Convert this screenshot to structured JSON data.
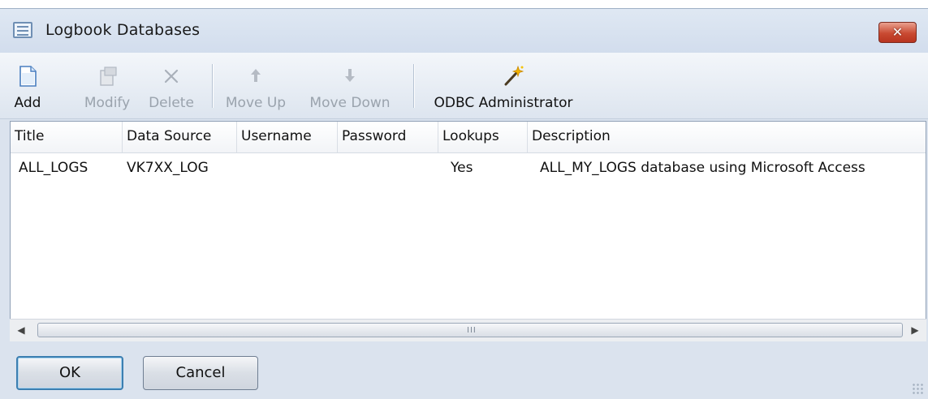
{
  "window": {
    "title": "Logbook Databases",
    "close_glyph": "✕"
  },
  "toolbar": {
    "buttons": [
      {
        "label": "Add",
        "icon": "new-document-icon",
        "enabled": true
      },
      {
        "label": "Modify",
        "icon": "modify-icon",
        "enabled": false
      },
      {
        "label": "Delete",
        "icon": "delete-x-icon",
        "enabled": false
      },
      {
        "label": "Move Up",
        "icon": "arrow-up-icon",
        "enabled": false
      },
      {
        "label": "Move Down",
        "icon": "arrow-down-icon",
        "enabled": false
      },
      {
        "label": "ODBC Administrator",
        "icon": "magic-wand-icon",
        "enabled": true
      }
    ]
  },
  "list": {
    "columns": [
      "Title",
      "Data Source",
      "Username",
      "Password",
      "Lookups",
      "Description"
    ],
    "rows": [
      {
        "title": "ALL_LOGS",
        "data_source": "VK7XX_LOG",
        "username": "",
        "password": "",
        "lookups": "Yes",
        "description": "ALL_MY_LOGS database using Microsoft Access"
      }
    ]
  },
  "scrollbar": {
    "left_arrow": "◀",
    "right_arrow": "▶",
    "grip": "III"
  },
  "footer": {
    "ok_label": "OK",
    "cancel_label": "Cancel"
  },
  "colors": {
    "window_bg": "#dbe3ee",
    "close_button": "#c94a32",
    "default_button_border": "#3c7fb1",
    "disabled_text": "#9aa3ad"
  }
}
